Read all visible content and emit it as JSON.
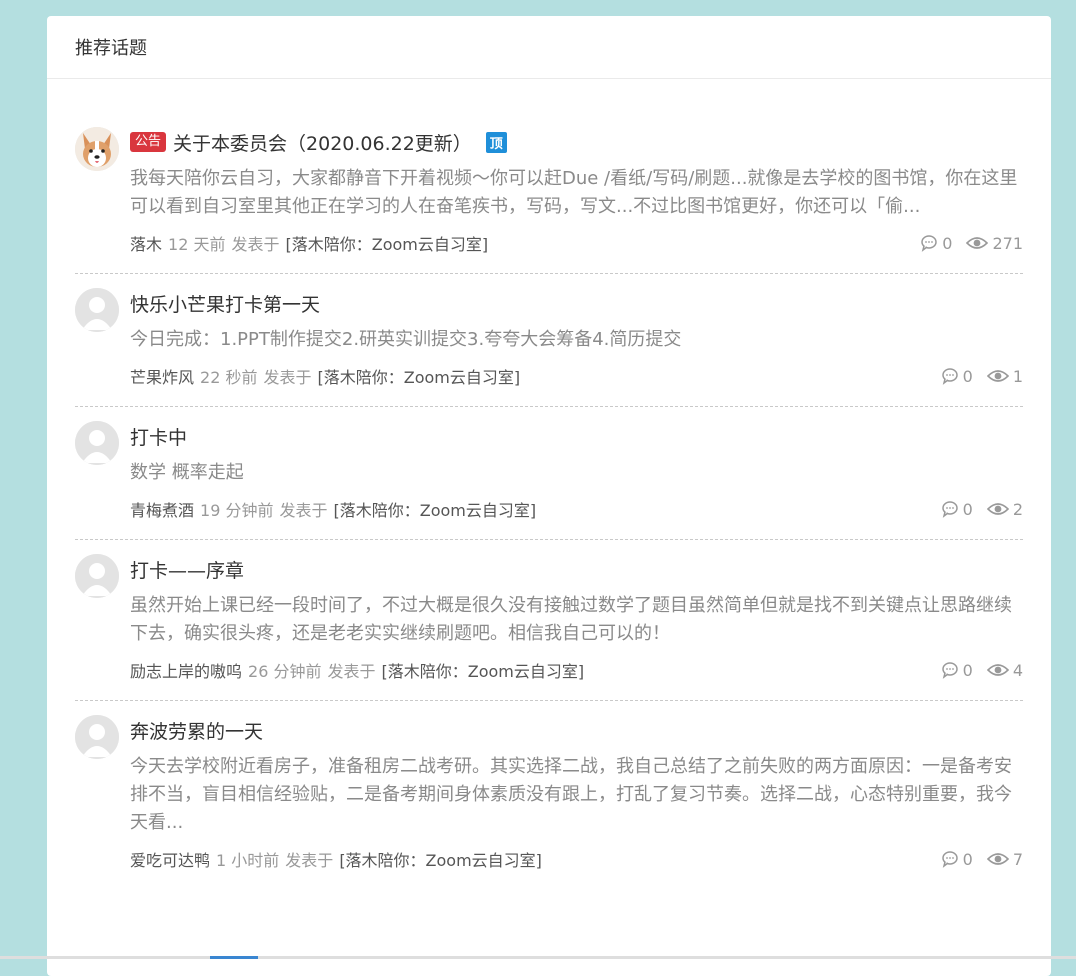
{
  "panel": {
    "title": "推荐话题"
  },
  "topics": [
    {
      "avatar": "corgi-avatar",
      "badge": "公告",
      "title": "关于本委员会（2020.06.22更新）",
      "pin": "顶",
      "excerpt": "我每天陪你云自习，大家都静音下开着视频～你可以赶Due /看纸/写码/刷题...就像是去学校的图书馆，你在这里可以看到自习室里其他正在学习的人在奋笔疾书，写码，写文...不过比图书馆更好，你还可以「偷...",
      "author": "落木",
      "time": "12 天前",
      "posted_in": "发表于",
      "group": "[落木陪你：Zoom云自习室]",
      "comments": "0",
      "views": "271"
    },
    {
      "avatar": "default-avatar",
      "title": "快乐小芒果打卡第一天",
      "excerpt": "今日完成：1.PPT制作提交2.研英实训提交3.夸夸大会筹备4.简历提交",
      "author": "芒果炸风",
      "time": "22 秒前",
      "posted_in": "发表于",
      "group": "[落木陪你：Zoom云自习室]",
      "comments": "0",
      "views": "1"
    },
    {
      "avatar": "default-avatar",
      "title": "打卡中",
      "excerpt": "数学 概率走起",
      "author": "青梅煮酒",
      "time": "19 分钟前",
      "posted_in": "发表于",
      "group": "[落木陪你：Zoom云自习室]",
      "comments": "0",
      "views": "2"
    },
    {
      "avatar": "default-avatar",
      "title": "打卡——序章",
      "excerpt": "虽然开始上课已经一段时间了，不过大概是很久没有接触过数学了题目虽然简单但就是找不到关键点让思路继续下去，确实很头疼，还是老老实实继续刷题吧。相信我自己可以的！",
      "author": "励志上岸的嗷呜",
      "time": "26 分钟前",
      "posted_in": "发表于",
      "group": "[落木陪你：Zoom云自习室]",
      "comments": "0",
      "views": "4"
    },
    {
      "avatar": "default-avatar",
      "title": "奔波劳累的一天",
      "excerpt": "今天去学校附近看房子，准备租房二战考研。其实选择二战，我自己总结了之前失败的两方面原因：一是备考安排不当，盲目相信经验贴，二是备考期间身体素质没有跟上，打乱了复习节奏。选择二战，心态特别重要，我今天看...",
      "author": "爱吃可达鸭",
      "time": "1 小时前",
      "posted_in": "发表于",
      "group": "[落木陪你：Zoom云自习室]",
      "comments": "0",
      "views": "7"
    }
  ]
}
